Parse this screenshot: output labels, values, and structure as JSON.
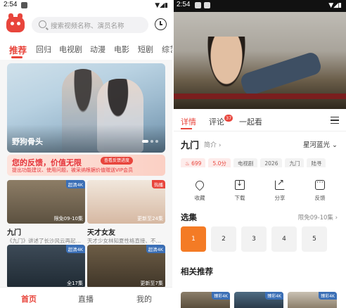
{
  "left": {
    "status": {
      "time": "2:54",
      "icons": "▼◢▮"
    },
    "search": {
      "placeholder": "搜索视频名称、演员名称"
    },
    "tabs": [
      {
        "label": "推荐",
        "active": true
      },
      {
        "label": "回归"
      },
      {
        "label": "电视剧"
      },
      {
        "label": "动漫"
      },
      {
        "label": "电影"
      },
      {
        "label": "短剧"
      },
      {
        "label": "综艺"
      }
    ],
    "banner": {
      "title": "野狗骨头"
    },
    "feedback": {
      "title": "您的反馈，价值无限",
      "subtitle": "提出功能建议、使用问题，被采纳根据价值赠送VIP会员",
      "button": "查看反馈进度"
    },
    "cards": [
      {
        "title": "九门",
        "desc": "《九门》讲述了长沙风云再起…",
        "badge": "超清4K",
        "badge_color": "blue",
        "ep": "限免09-10集"
      },
      {
        "title": "天才女友",
        "desc": "天才少女林知夏性格直接、不…",
        "badge": "热播",
        "badge_color": "red",
        "ep": "更新至24集"
      },
      {
        "title": "",
        "desc": "",
        "badge": "超清4K",
        "badge_color": "blue",
        "ep": "全17集"
      },
      {
        "title": "",
        "desc": "",
        "badge": "超清4K",
        "badge_color": "blue",
        "ep": "更新至7集"
      }
    ],
    "bottom_nav": [
      {
        "label": "首页",
        "active": true
      },
      {
        "label": "直播"
      },
      {
        "label": "我的"
      }
    ]
  },
  "right": {
    "status": {
      "time": "2:54",
      "icons": "▼◢▮"
    },
    "tabs": [
      {
        "label": "详情",
        "active": true
      },
      {
        "label": "评论"
      },
      {
        "label": "一起看"
      }
    ],
    "comment_count": "37",
    "title": "九门",
    "intro_link": "简介 ›",
    "source": "星河蓝光 ⌄",
    "tags": [
      {
        "label": "♨ 699",
        "kind": "hot"
      },
      {
        "label": "5.0分",
        "kind": "score"
      },
      {
        "label": "电视剧"
      },
      {
        "label": "2026"
      },
      {
        "label": "九门"
      },
      {
        "label": "陆寻"
      }
    ],
    "actions": [
      {
        "label": "收藏",
        "icon": "heart-icon"
      },
      {
        "label": "下载",
        "icon": "download-icon"
      },
      {
        "label": "分享",
        "icon": "share-icon"
      },
      {
        "label": "反馈",
        "icon": "feedback-icon"
      }
    ],
    "episodes_header": "选集",
    "episodes_update": "限免09-10集 ›",
    "episodes": [
      "1",
      "2",
      "3",
      "4",
      "5"
    ],
    "recommend_header": "相关推荐",
    "recommend_badges": [
      "臻彩4K",
      "臻彩4K",
      "臻彩4K"
    ]
  }
}
